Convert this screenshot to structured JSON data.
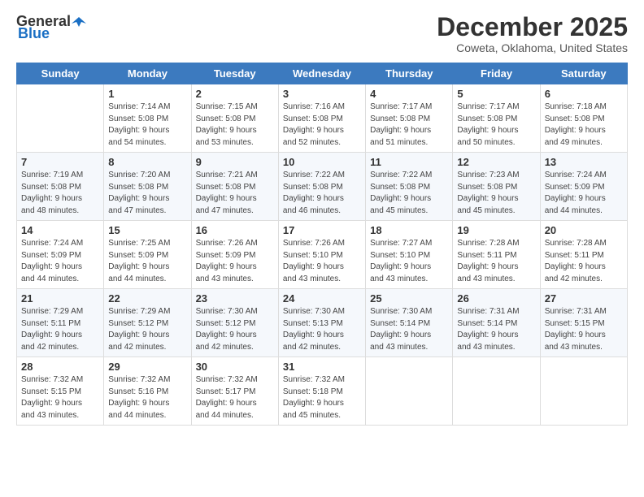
{
  "header": {
    "logo_general": "General",
    "logo_blue": "Blue",
    "month_title": "December 2025",
    "location": "Coweta, Oklahoma, United States"
  },
  "days_of_week": [
    "Sunday",
    "Monday",
    "Tuesday",
    "Wednesday",
    "Thursday",
    "Friday",
    "Saturday"
  ],
  "weeks": [
    [
      {
        "day": "",
        "info": ""
      },
      {
        "day": "1",
        "info": "Sunrise: 7:14 AM\nSunset: 5:08 PM\nDaylight: 9 hours\nand 54 minutes."
      },
      {
        "day": "2",
        "info": "Sunrise: 7:15 AM\nSunset: 5:08 PM\nDaylight: 9 hours\nand 53 minutes."
      },
      {
        "day": "3",
        "info": "Sunrise: 7:16 AM\nSunset: 5:08 PM\nDaylight: 9 hours\nand 52 minutes."
      },
      {
        "day": "4",
        "info": "Sunrise: 7:17 AM\nSunset: 5:08 PM\nDaylight: 9 hours\nand 51 minutes."
      },
      {
        "day": "5",
        "info": "Sunrise: 7:17 AM\nSunset: 5:08 PM\nDaylight: 9 hours\nand 50 minutes."
      },
      {
        "day": "6",
        "info": "Sunrise: 7:18 AM\nSunset: 5:08 PM\nDaylight: 9 hours\nand 49 minutes."
      }
    ],
    [
      {
        "day": "7",
        "info": "Sunrise: 7:19 AM\nSunset: 5:08 PM\nDaylight: 9 hours\nand 48 minutes."
      },
      {
        "day": "8",
        "info": "Sunrise: 7:20 AM\nSunset: 5:08 PM\nDaylight: 9 hours\nand 47 minutes."
      },
      {
        "day": "9",
        "info": "Sunrise: 7:21 AM\nSunset: 5:08 PM\nDaylight: 9 hours\nand 47 minutes."
      },
      {
        "day": "10",
        "info": "Sunrise: 7:22 AM\nSunset: 5:08 PM\nDaylight: 9 hours\nand 46 minutes."
      },
      {
        "day": "11",
        "info": "Sunrise: 7:22 AM\nSunset: 5:08 PM\nDaylight: 9 hours\nand 45 minutes."
      },
      {
        "day": "12",
        "info": "Sunrise: 7:23 AM\nSunset: 5:08 PM\nDaylight: 9 hours\nand 45 minutes."
      },
      {
        "day": "13",
        "info": "Sunrise: 7:24 AM\nSunset: 5:09 PM\nDaylight: 9 hours\nand 44 minutes."
      }
    ],
    [
      {
        "day": "14",
        "info": "Sunrise: 7:24 AM\nSunset: 5:09 PM\nDaylight: 9 hours\nand 44 minutes."
      },
      {
        "day": "15",
        "info": "Sunrise: 7:25 AM\nSunset: 5:09 PM\nDaylight: 9 hours\nand 44 minutes."
      },
      {
        "day": "16",
        "info": "Sunrise: 7:26 AM\nSunset: 5:09 PM\nDaylight: 9 hours\nand 43 minutes."
      },
      {
        "day": "17",
        "info": "Sunrise: 7:26 AM\nSunset: 5:10 PM\nDaylight: 9 hours\nand 43 minutes."
      },
      {
        "day": "18",
        "info": "Sunrise: 7:27 AM\nSunset: 5:10 PM\nDaylight: 9 hours\nand 43 minutes."
      },
      {
        "day": "19",
        "info": "Sunrise: 7:28 AM\nSunset: 5:11 PM\nDaylight: 9 hours\nand 43 minutes."
      },
      {
        "day": "20",
        "info": "Sunrise: 7:28 AM\nSunset: 5:11 PM\nDaylight: 9 hours\nand 42 minutes."
      }
    ],
    [
      {
        "day": "21",
        "info": "Sunrise: 7:29 AM\nSunset: 5:11 PM\nDaylight: 9 hours\nand 42 minutes."
      },
      {
        "day": "22",
        "info": "Sunrise: 7:29 AM\nSunset: 5:12 PM\nDaylight: 9 hours\nand 42 minutes."
      },
      {
        "day": "23",
        "info": "Sunrise: 7:30 AM\nSunset: 5:12 PM\nDaylight: 9 hours\nand 42 minutes."
      },
      {
        "day": "24",
        "info": "Sunrise: 7:30 AM\nSunset: 5:13 PM\nDaylight: 9 hours\nand 42 minutes."
      },
      {
        "day": "25",
        "info": "Sunrise: 7:30 AM\nSunset: 5:14 PM\nDaylight: 9 hours\nand 43 minutes."
      },
      {
        "day": "26",
        "info": "Sunrise: 7:31 AM\nSunset: 5:14 PM\nDaylight: 9 hours\nand 43 minutes."
      },
      {
        "day": "27",
        "info": "Sunrise: 7:31 AM\nSunset: 5:15 PM\nDaylight: 9 hours\nand 43 minutes."
      }
    ],
    [
      {
        "day": "28",
        "info": "Sunrise: 7:32 AM\nSunset: 5:15 PM\nDaylight: 9 hours\nand 43 minutes."
      },
      {
        "day": "29",
        "info": "Sunrise: 7:32 AM\nSunset: 5:16 PM\nDaylight: 9 hours\nand 44 minutes."
      },
      {
        "day": "30",
        "info": "Sunrise: 7:32 AM\nSunset: 5:17 PM\nDaylight: 9 hours\nand 44 minutes."
      },
      {
        "day": "31",
        "info": "Sunrise: 7:32 AM\nSunset: 5:18 PM\nDaylight: 9 hours\nand 45 minutes."
      },
      {
        "day": "",
        "info": ""
      },
      {
        "day": "",
        "info": ""
      },
      {
        "day": "",
        "info": ""
      }
    ]
  ]
}
